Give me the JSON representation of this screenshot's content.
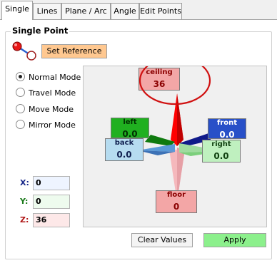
{
  "tabs": [
    {
      "label": "Single",
      "active": true
    },
    {
      "label": "Lines"
    },
    {
      "label": "Plane / Arc"
    },
    {
      "label": "Angle"
    },
    {
      "label": "Edit Points"
    }
  ],
  "group": {
    "title": "Single Point"
  },
  "set_reference": "Set Reference",
  "modes": [
    {
      "label": "Normal Mode",
      "checked": true
    },
    {
      "label": "Travel Mode"
    },
    {
      "label": "Move Mode"
    },
    {
      "label": "Mirror Mode"
    }
  ],
  "coords": {
    "x": {
      "label": "X:",
      "value": "0",
      "label_color": "#1a2a8a",
      "bg": "#eef4ff"
    },
    "y": {
      "label": "Y:",
      "value": "0",
      "label_color": "#1a7a1a",
      "bg": "#eefbee"
    },
    "z": {
      "label": "Z:",
      "value": "36",
      "label_color": "#b01818",
      "bg": "#fde8e8"
    }
  },
  "directions": {
    "ceiling": {
      "label": "ceiling",
      "value": "36",
      "color": "#f3a6a6",
      "text": "#8a0000"
    },
    "left": {
      "label": "left",
      "value": "0.0",
      "color": "#20b020",
      "text": "#003000"
    },
    "front": {
      "label": "front",
      "value": "0.0",
      "color": "#2850c8",
      "text": "#ffffff"
    },
    "back": {
      "label": "back",
      "value": "0.0",
      "color": "#b6dcf0",
      "text": "#102050"
    },
    "right": {
      "label": "right",
      "value": "0.0",
      "color": "#bff0bf",
      "text": "#104010"
    },
    "floor": {
      "label": "floor",
      "value": "0",
      "color": "#f3a6a6",
      "text": "#8a0000"
    }
  },
  "buttons": {
    "clear": "Clear Values",
    "apply": "Apply"
  },
  "colors": {
    "highlight_circle": "#d01010",
    "apply_bg": "#8cf08c"
  }
}
